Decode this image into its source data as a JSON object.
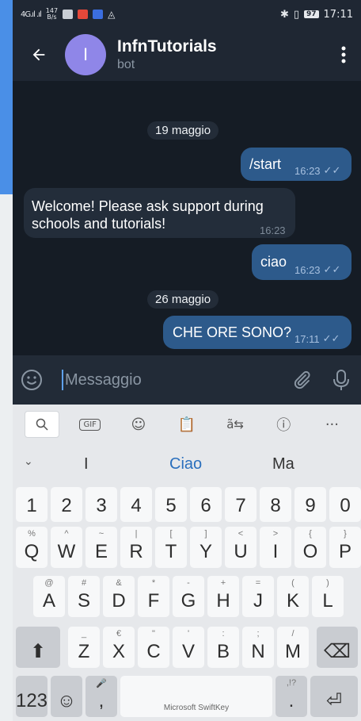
{
  "status_bar": {
    "network": "4G",
    "speed_value": "147",
    "speed_unit": "B/s",
    "battery": "97",
    "time": "17:11"
  },
  "chat_header": {
    "avatar_letter": "I",
    "title": "InfnTutorials",
    "subtitle": "bot"
  },
  "messages": [
    {
      "type": "date",
      "text": "19 maggio"
    },
    {
      "type": "outgoing",
      "text": "/start",
      "time": "16:23"
    },
    {
      "type": "incoming",
      "text_line1": "Welcome! Please ask support during",
      "text_line2": "schools and tutorials!",
      "time": "16:23"
    },
    {
      "type": "outgoing",
      "text": "ciao",
      "time": "16:23"
    },
    {
      "type": "date",
      "text": "26 maggio"
    },
    {
      "type": "outgoing",
      "text": "CHE ORE SONO?",
      "time": "17:11"
    }
  ],
  "input": {
    "placeholder": "Messaggio"
  },
  "keyboard": {
    "suggestions": [
      "I",
      "Ciao",
      "Ma"
    ],
    "toolbar_labels": {
      "gif": "GIF",
      "more": "···"
    },
    "numbers": [
      "1",
      "2",
      "3",
      "4",
      "5",
      "6",
      "7",
      "8",
      "9",
      "0"
    ],
    "row1": [
      {
        "k": "Q",
        "a": "%"
      },
      {
        "k": "W",
        "a": "^"
      },
      {
        "k": "E",
        "a": "~"
      },
      {
        "k": "R",
        "a": "|"
      },
      {
        "k": "T",
        "a": "["
      },
      {
        "k": "Y",
        "a": "]"
      },
      {
        "k": "U",
        "a": "<"
      },
      {
        "k": "I",
        "a": ">"
      },
      {
        "k": "O",
        "a": "{"
      },
      {
        "k": "P",
        "a": "}"
      }
    ],
    "row2": [
      {
        "k": "A",
        "a": "@"
      },
      {
        "k": "S",
        "a": "#"
      },
      {
        "k": "D",
        "a": "&"
      },
      {
        "k": "F",
        "a": "*"
      },
      {
        "k": "G",
        "a": "-"
      },
      {
        "k": "H",
        "a": "+"
      },
      {
        "k": "J",
        "a": "="
      },
      {
        "k": "K",
        "a": "("
      },
      {
        "k": "L",
        "a": ")"
      }
    ],
    "row3": [
      {
        "k": "Z",
        "a": "_"
      },
      {
        "k": "X",
        "a": "€"
      },
      {
        "k": "C",
        "a": "\""
      },
      {
        "k": "V",
        "a": "'"
      },
      {
        "k": "B",
        "a": ":"
      },
      {
        "k": "N",
        "a": ";"
      },
      {
        "k": "M",
        "a": "/"
      }
    ],
    "bottom": {
      "numbers_label": "123",
      "comma": ",",
      "space_label": "Microsoft SwiftKey",
      "period": ".",
      "period_alt": ",!?"
    }
  },
  "colors": {
    "chat_bg": "#151c25",
    "header_bg": "#1f2733",
    "outgoing_bubble": "#2d5a8b",
    "incoming_bubble": "#232d3a",
    "accent": "#5ea1ec"
  }
}
